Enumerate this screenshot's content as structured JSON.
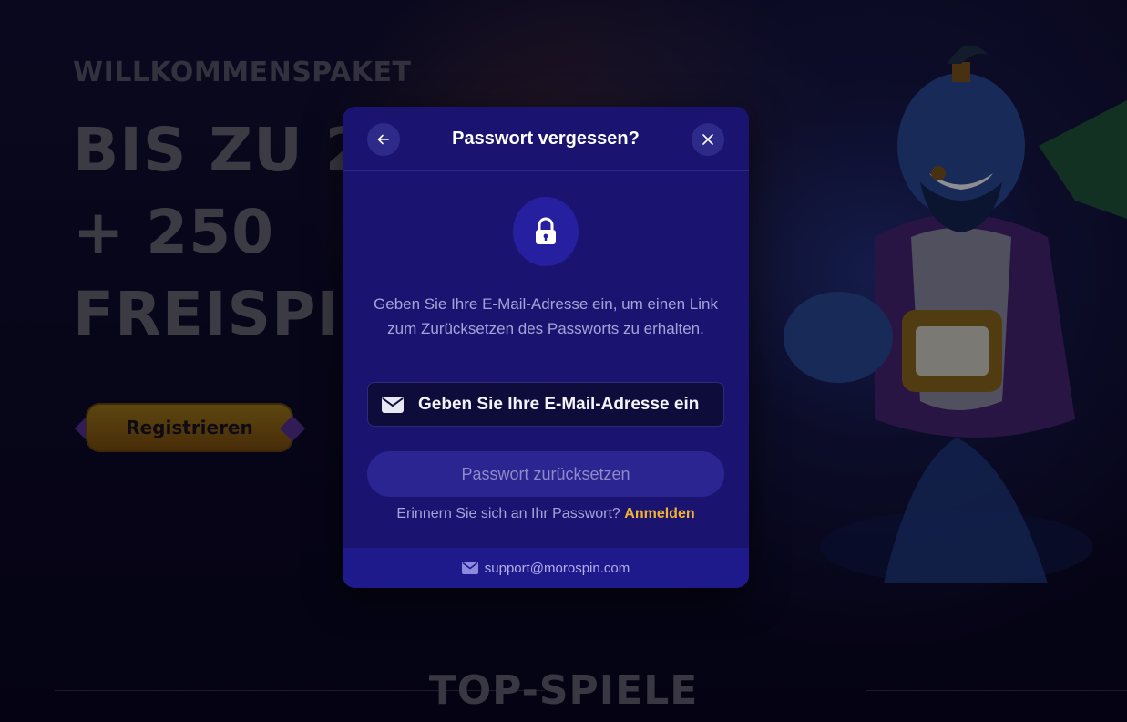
{
  "background": {
    "promo": {
      "kicker": "WILLKOMMENSPAKET",
      "line1": "BIS ZU 2",
      "line2": "+ 250",
      "line3": "FREISPI"
    },
    "register_label": "Registrieren",
    "section_title": "TOP-SPIELE"
  },
  "modal": {
    "title": "Passwort vergessen?",
    "back_icon": "arrow-left-icon",
    "close_icon": "close-icon",
    "lock_icon": "lock-icon",
    "description": "Geben Sie Ihre E-Mail-Adresse ein, um einen Link zum Zurücksetzen des Passworts zu erhalten.",
    "email_placeholder": "Geben Sie Ihre E-Mail-Adresse ein",
    "submit_label": "Passwort zurücksetzen",
    "remember_text": "Erinnern Sie sich an Ihr Passwort?",
    "login_link": "Anmelden",
    "support_email": "support@morospin.com"
  },
  "colors": {
    "modal_bg": "#1a1470",
    "accent_link": "#f2b233",
    "text_muted": "#a7a3d8"
  }
}
